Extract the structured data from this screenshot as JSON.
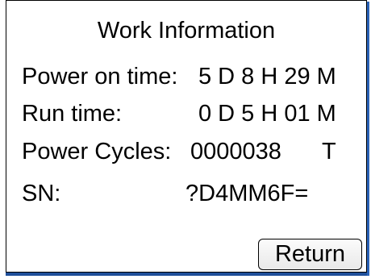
{
  "dialog": {
    "title": "Work Information"
  },
  "power_on_time": {
    "label": "Power on time:",
    "value": "5 D 8 H 29 M"
  },
  "run_time": {
    "label": "Run time:",
    "value": "0 D 5 H 01 M"
  },
  "power_cycles": {
    "label": "Power Cycles:",
    "value": "0000038",
    "unit": "T"
  },
  "serial_number": {
    "label": "SN:",
    "value": "?D4MM6F="
  },
  "actions": {
    "return_label": "Return"
  },
  "colors": {
    "border": "#000000",
    "shadow": "#1f4f9a",
    "background": "#ffffff"
  }
}
